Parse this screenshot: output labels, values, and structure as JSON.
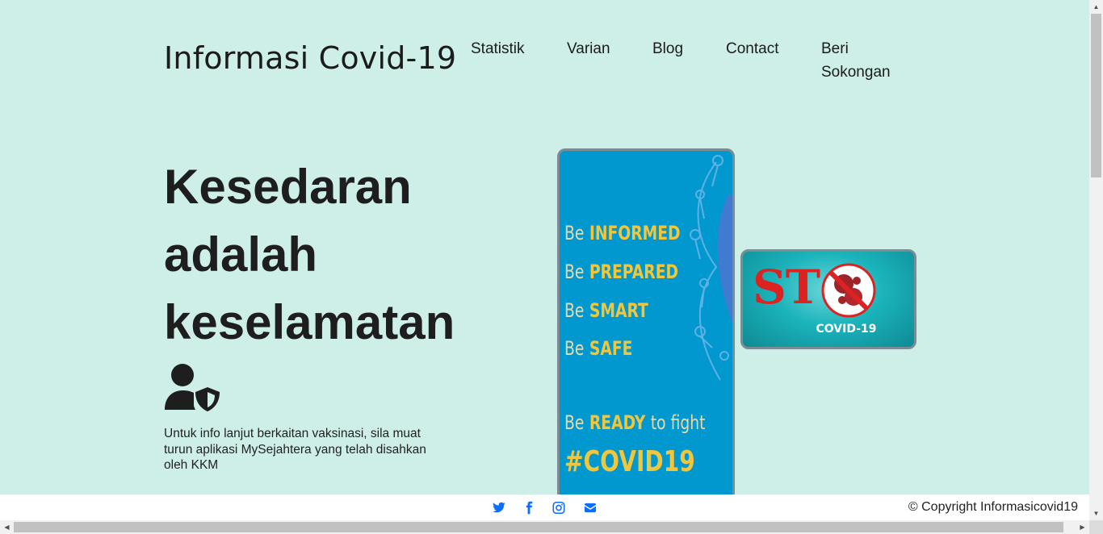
{
  "header": {
    "brand": "Informasi Covid-19",
    "nav": {
      "statistik": "Statistik",
      "varian": "Varian",
      "blog": "Blog",
      "contact": "Contact",
      "beri_sokongan": "Beri Sokongan"
    }
  },
  "hero": {
    "title_lines": [
      "Kesedaran",
      "adalah",
      "keselamatan"
    ],
    "icon": "user-shield-icon",
    "info": "Untuk info lanjut berkaitan vaksinasi, sila muat turun aplikasi MySejahtera yang telah disahkan oleh KKM"
  },
  "poster": {
    "lines": [
      {
        "be": "Be",
        "word": "INFORMED"
      },
      {
        "be": "Be",
        "word": "PREPARED"
      },
      {
        "be": "Be",
        "word": "SMART"
      },
      {
        "be": "Be",
        "word": "SAFE"
      }
    ],
    "ready_be": "Be",
    "ready_word": "READY",
    "ready_rest": "to fight",
    "hashtag": "#COVID19"
  },
  "stop_badge": {
    "word": "ST  P",
    "tag": "COVID-19"
  },
  "footer": {
    "icons": [
      "twitter-icon",
      "facebook-icon",
      "instagram-icon",
      "email-icon"
    ],
    "copyright": "© Copyright Informasicovid19"
  },
  "colors": {
    "background": "#cdefe8",
    "poster_blue": "#0098cf",
    "poster_yellow": "#f0c63c",
    "stop_red": "#dd2222",
    "social_blue": "#0d6efd"
  }
}
